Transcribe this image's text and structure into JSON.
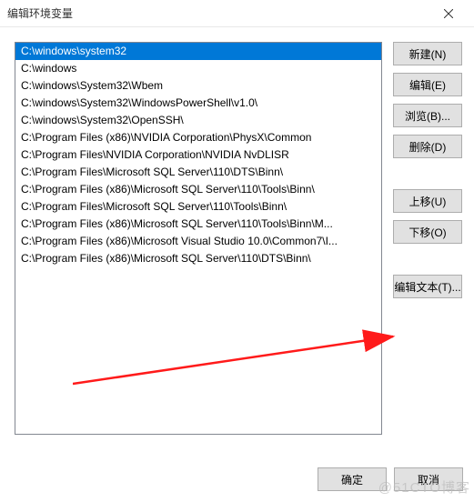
{
  "window": {
    "title": "编辑环境变量"
  },
  "paths": [
    "C:\\windows\\system32",
    "C:\\windows",
    "C:\\windows\\System32\\Wbem",
    "C:\\windows\\System32\\WindowsPowerShell\\v1.0\\",
    "C:\\windows\\System32\\OpenSSH\\",
    "C:\\Program Files (x86)\\NVIDIA Corporation\\PhysX\\Common",
    "C:\\Program Files\\NVIDIA Corporation\\NVIDIA NvDLISR",
    "C:\\Program Files\\Microsoft SQL Server\\110\\DTS\\Binn\\",
    "C:\\Program Files (x86)\\Microsoft SQL Server\\110\\Tools\\Binn\\",
    "C:\\Program Files\\Microsoft SQL Server\\110\\Tools\\Binn\\",
    "C:\\Program Files (x86)\\Microsoft SQL Server\\110\\Tools\\Binn\\M...",
    "C:\\Program Files (x86)\\Microsoft Visual Studio 10.0\\Common7\\I...",
    "C:\\Program Files (x86)\\Microsoft SQL Server\\110\\DTS\\Binn\\"
  ],
  "selected_index": 0,
  "buttons": {
    "new": "新建(N)",
    "edit": "编辑(E)",
    "browse": "浏览(B)...",
    "delete": "删除(D)",
    "moveup": "上移(U)",
    "movedown": "下移(O)",
    "edittext": "编辑文本(T)...",
    "ok": "确定",
    "cancel": "取消"
  },
  "watermark": "@51CTO博客"
}
